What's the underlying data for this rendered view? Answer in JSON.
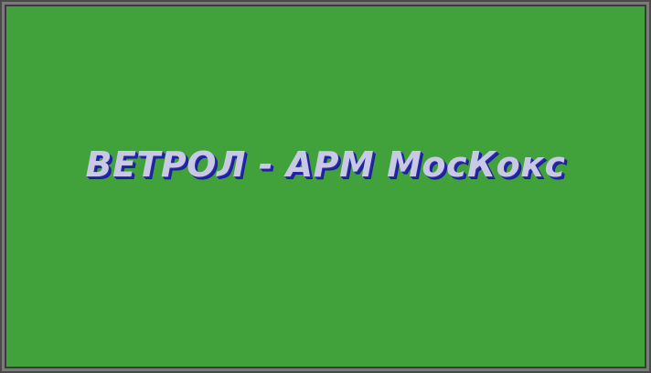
{
  "splash": {
    "title": "ВЕТРОЛ - АРМ МосКокс"
  },
  "colors": {
    "background": "#41a23b",
    "frame": "#7a7a7a",
    "title_text": "#c9c9e6",
    "title_shadow": "#2222a8"
  }
}
